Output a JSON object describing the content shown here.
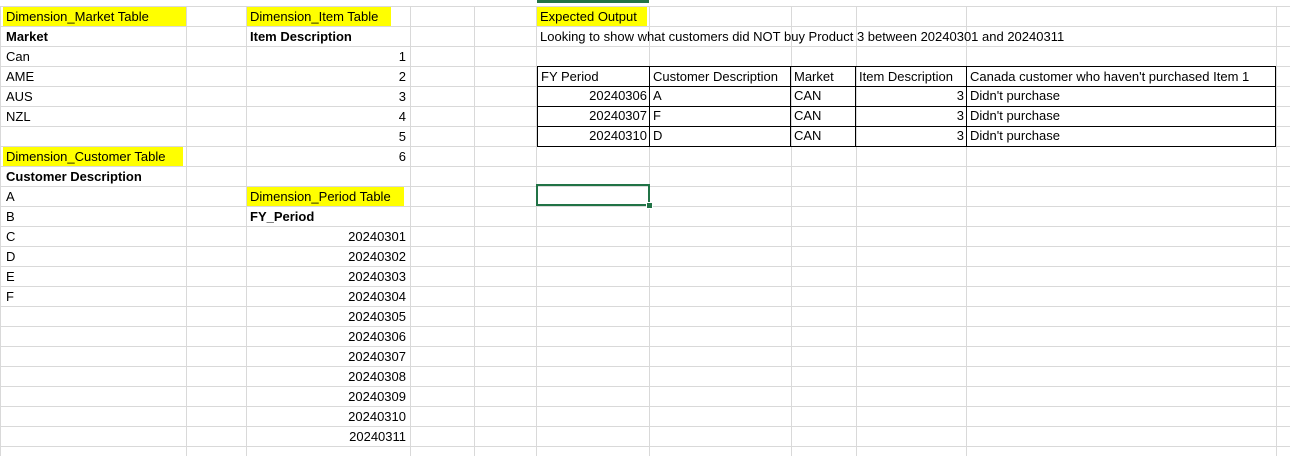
{
  "market": {
    "title": "Dimension_Market Table",
    "header": "Market",
    "values": [
      "Can",
      "AME",
      "AUS",
      "NZL"
    ]
  },
  "item": {
    "title": "Dimension_Item Table",
    "header": "Item Description",
    "values": [
      "1",
      "2",
      "3",
      "4",
      "5",
      "6"
    ]
  },
  "customer": {
    "title": "Dimension_Customer Table",
    "header": "Customer Description",
    "values": [
      "A",
      "B",
      "C",
      "D",
      "E",
      "F"
    ]
  },
  "period": {
    "title": "Dimension_Period Table",
    "header": "FY_Period",
    "values": [
      "20240301",
      "20240302",
      "20240303",
      "20240304",
      "20240305",
      "20240306",
      "20240307",
      "20240308",
      "20240309",
      "20240310",
      "20240311"
    ]
  },
  "expected": {
    "title": "Expected Output",
    "description": "Looking to show what customers did NOT buy Product 3 between 20240301 and 20240311",
    "headers": [
      "FY Period",
      "Customer Description",
      "Market",
      "Item Description",
      "Canada customer who haven't purchased Item 1"
    ],
    "rows": [
      [
        "20240306",
        "A",
        "CAN",
        "3",
        "Didn't purchase"
      ],
      [
        "20240307",
        "F",
        "CAN",
        "3",
        "Didn't purchase"
      ],
      [
        "20240310",
        "D",
        "CAN",
        "3",
        "Didn't purchase"
      ]
    ]
  },
  "colors": {
    "highlight": "#ffff00",
    "gridline": "#d9d9d9",
    "selection": "#217346"
  }
}
